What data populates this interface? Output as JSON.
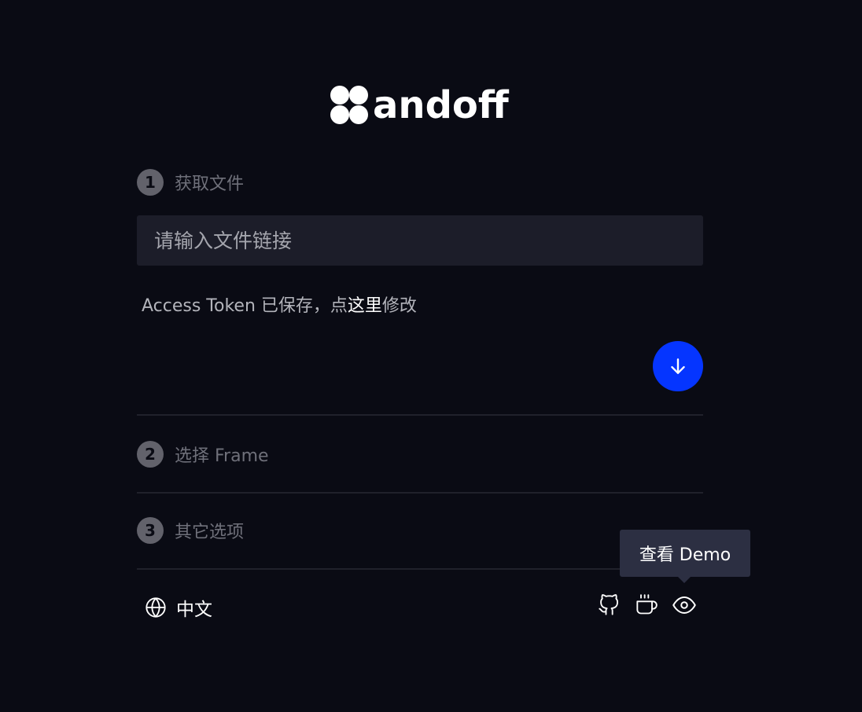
{
  "logo": {
    "text": "andoff"
  },
  "steps": [
    {
      "number": "1",
      "title": "获取文件"
    },
    {
      "number": "2",
      "title": "选择 Frame"
    },
    {
      "number": "3",
      "title": "其它选项"
    }
  ],
  "file_input": {
    "placeholder": "请输入文件链接",
    "value": ""
  },
  "token_note": {
    "prefix": "Access Token 已保存，点",
    "link": "这里",
    "suffix": "修改"
  },
  "fetch_button": {
    "icon": "arrow-down-icon",
    "color": "#0535ff"
  },
  "footer": {
    "language_icon": "globe-icon",
    "language_label": "中文",
    "icons": [
      "github-icon",
      "coffee-icon",
      "eye-icon"
    ]
  },
  "tooltip": {
    "text": "查看 Demo"
  }
}
